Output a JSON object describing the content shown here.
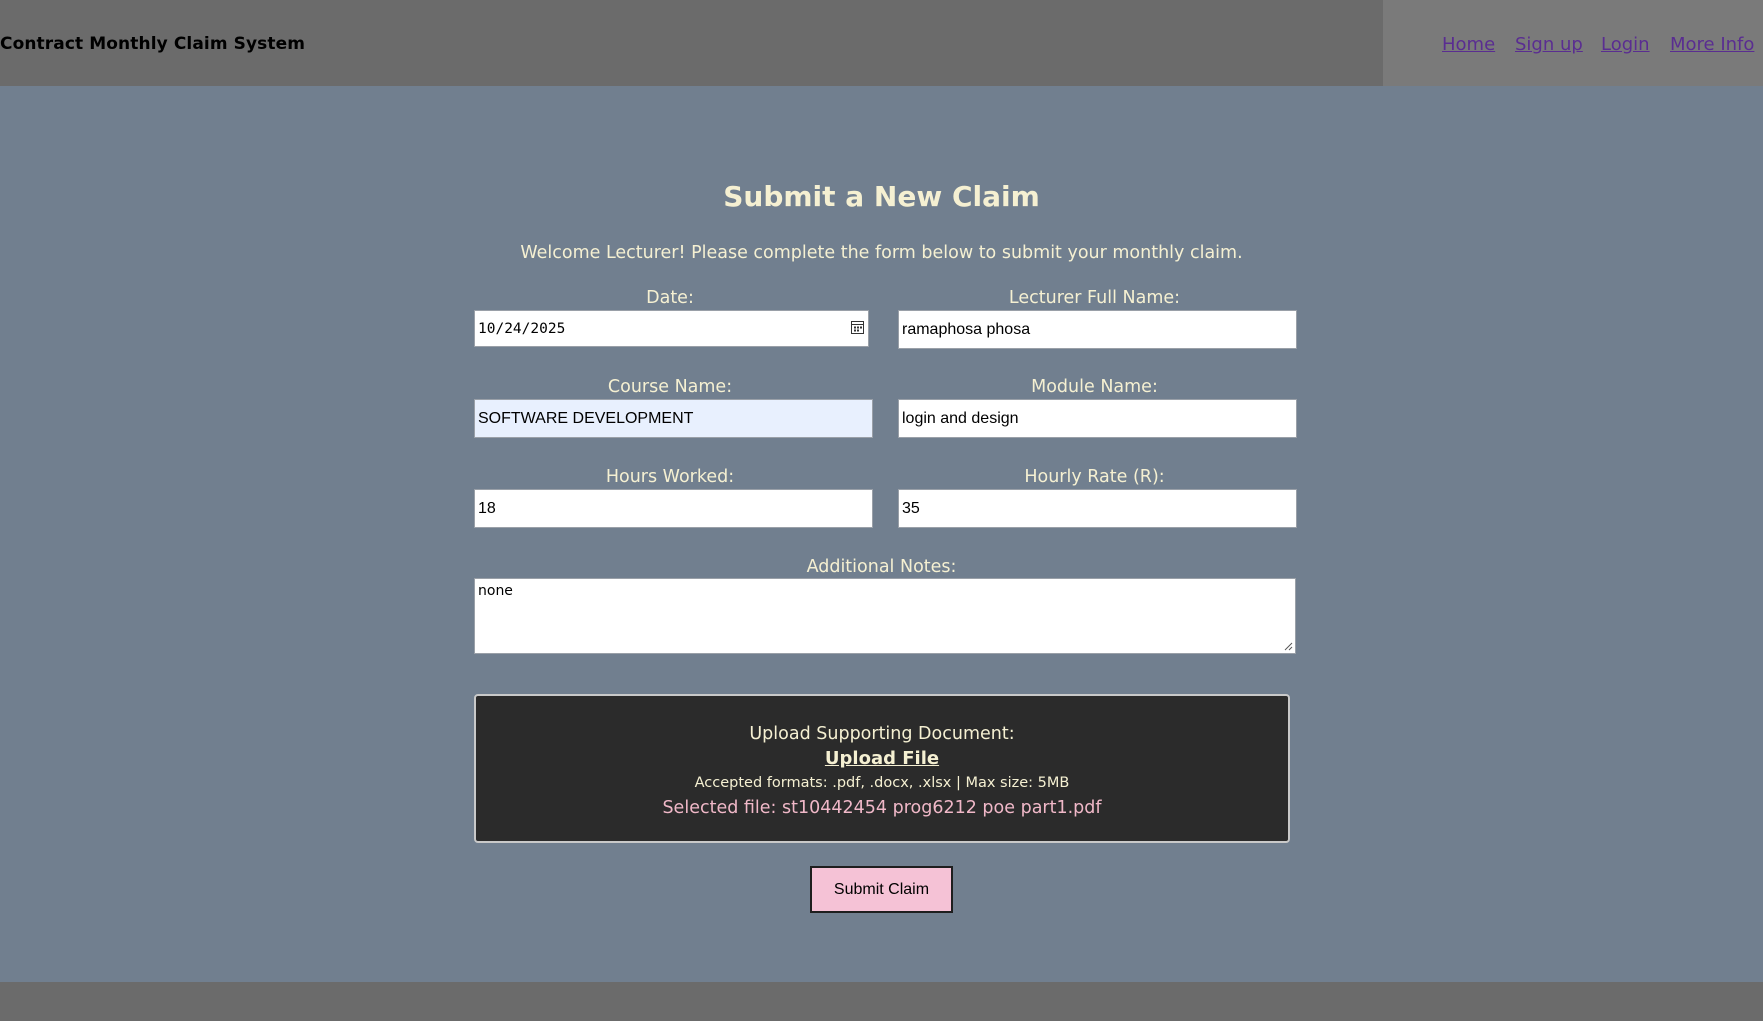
{
  "header": {
    "brand": "Contract Monthly Claim System",
    "nav": [
      {
        "label": "Home"
      },
      {
        "label": "Sign up"
      },
      {
        "label": "Login"
      },
      {
        "label": "More Info"
      }
    ]
  },
  "form": {
    "title": "Submit a New Claim",
    "welcome": "Welcome Lecturer! Please complete the form below to submit your monthly claim.",
    "date": {
      "label": "Date:",
      "value": "10/24/2025",
      "icon": "calendar-icon"
    },
    "lecturer_name": {
      "label": "Lecturer Full Name:",
      "value": "ramaphosa phosa"
    },
    "course_name": {
      "label": "Course Name:",
      "value": "SOFTWARE DEVELOPMENT"
    },
    "module_name": {
      "label": "Module Name:",
      "value": "login and design"
    },
    "hours_worked": {
      "label": "Hours Worked:",
      "value": "18"
    },
    "hourly_rate": {
      "label": "Hourly Rate (R):",
      "value": "35"
    },
    "notes": {
      "label": "Additional Notes:",
      "value": "none"
    },
    "upload": {
      "label": "Upload Supporting Document:",
      "button": "Upload File",
      "formats": "Accepted formats: .pdf, .docx, .xlsx | Max size: 5MB",
      "selected": "Selected file: st10442454 prog6212 poe part1.pdf"
    },
    "submit_label": "Submit Claim"
  },
  "colors": {
    "page_background": "#717f8f",
    "header_background": "#6b6b6b",
    "nav_background": "#7a7a7a",
    "link": "#5a2d91",
    "text_light": "#f5f0d2",
    "upload_background": "#2b2b2b",
    "selected_file_text": "#f0b8c8",
    "submit_button": "#f5c2d6",
    "autofill_field": "#e8f0fe"
  }
}
